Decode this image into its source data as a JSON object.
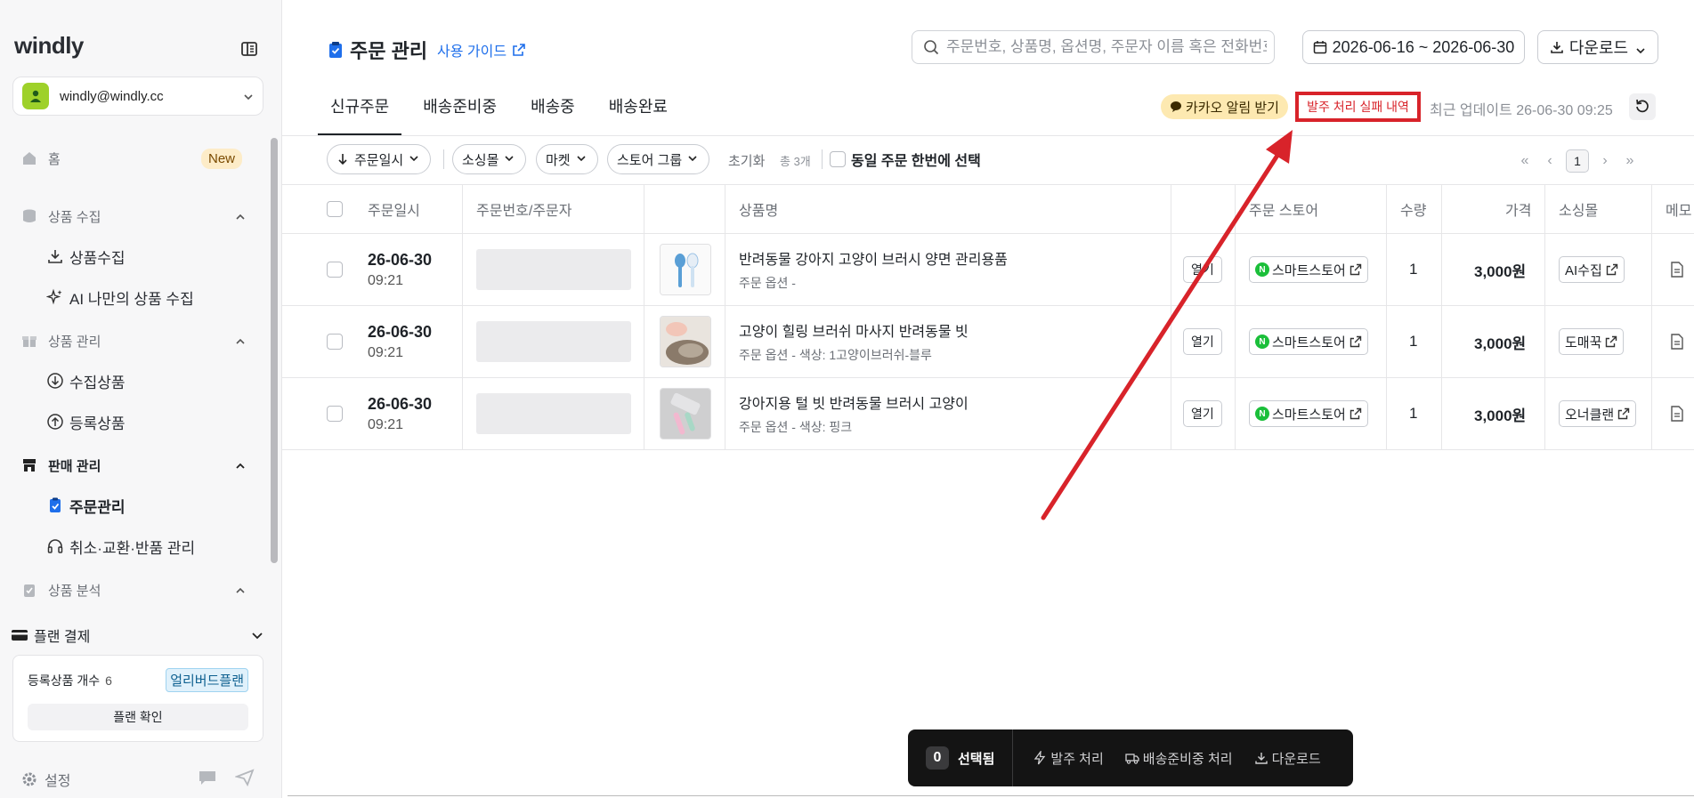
{
  "sidebar": {
    "logo": "windly",
    "account_email": "windly@windly.cc",
    "home": {
      "label": "홈",
      "badge": "New"
    },
    "groups": [
      {
        "label": "상품 수집",
        "items": [
          "상품수집",
          "AI 나만의 상품 수집"
        ]
      },
      {
        "label": "상품 관리",
        "items": [
          "수집상품",
          "등록상품"
        ]
      },
      {
        "label": "판매 관리",
        "items": [
          "주문관리",
          "취소·교환·반품 관리"
        ]
      },
      {
        "label": "상품 분석",
        "items": []
      }
    ],
    "plan": {
      "header": "플랜 결제",
      "count_label": "등록상품 개수",
      "count_value": "6",
      "tag": "얼리버드플랜",
      "button": "플랜 확인"
    },
    "settings": "설정"
  },
  "header": {
    "title": "주문 관리",
    "guide": "사용 가이드",
    "search_placeholder": "주문번호, 상품명, 옵션명, 주문자 이름 혹은 전화번호",
    "date_range": "2026-06-16 ~ 2026-06-30",
    "download": "다운로드"
  },
  "tabs": [
    "신규주문",
    "배송준비중",
    "배송중",
    "배송완료"
  ],
  "status": {
    "kakao": "카카오 알림 받기",
    "fail_history": "발주 처리 실패 내역",
    "updated": "최근 업데이트 26-06-30 09:25"
  },
  "filters": {
    "sort": "주문일시",
    "sourcing": "소싱몰",
    "market": "마켓",
    "store_group": "스토어 그룹",
    "reset": "초기화",
    "total": "총 3개",
    "same_order": "동일 주문 한번에 선택",
    "page": "1"
  },
  "table": {
    "columns": [
      "주문일시",
      "주문번호/주문자",
      "상품명",
      "주문 스토어",
      "수량",
      "가격",
      "소싱몰",
      "메모"
    ],
    "rows": [
      {
        "date": "26-06-30",
        "time": "09:21",
        "name": "반려동물 강아지 고양이 브러시 양면 관리용품",
        "option": "주문 옵션 -",
        "open": "열기",
        "store": "스마트스토어",
        "qty": "1",
        "price": "3,000원",
        "sourcing": "AI수집"
      },
      {
        "date": "26-06-30",
        "time": "09:21",
        "name": "고양이 힐링 브러쉬 마사지 반려동물 빗",
        "option": "주문 옵션 - 색상: 1고양이브러쉬-블루",
        "open": "열기",
        "store": "스마트스토어",
        "qty": "1",
        "price": "3,000원",
        "sourcing": "도매꾹"
      },
      {
        "date": "26-06-30",
        "time": "09:21",
        "name": "강아지용 털 빗 반려동물 브러시 고양이",
        "option": "주문 옵션 - 색상: 핑크",
        "open": "열기",
        "store": "스마트스토어",
        "qty": "1",
        "price": "3,000원",
        "sourcing": "오너클랜"
      }
    ]
  },
  "action_bar": {
    "count": "0",
    "selected": "선택됨",
    "order_process": "발주 처리",
    "shipping_prep": "배송준비중 처리",
    "download": "다운로드"
  },
  "colors": {
    "accent": "#1f6feb",
    "highlight": "#d8232a",
    "kakao": "#fde9b1",
    "naver": "#1bbf3a"
  }
}
